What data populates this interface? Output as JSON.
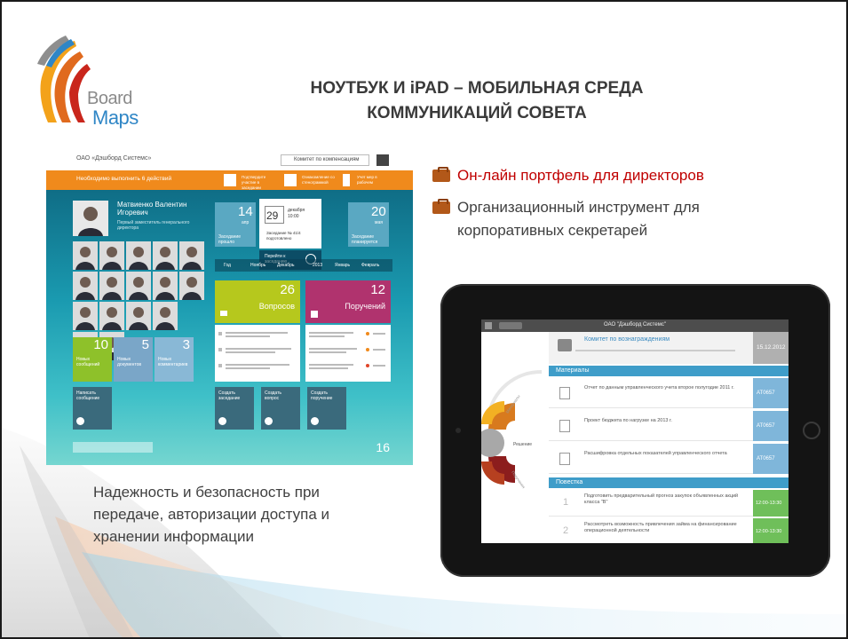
{
  "slide": {
    "title_line1": "НОУТБУК И iPAD – МОБИЛЬНАЯ  СРЕДА",
    "title_line2": "КОММУНИКАЦИЙ СОВЕТА"
  },
  "logo": {
    "line1": "Board",
    "line2": "Maps"
  },
  "bullets": [
    {
      "text": "Он-лайн портфель для директоров",
      "color": "#c00000"
    },
    {
      "text": "Организационный инструмент для корпоративных секретарей",
      "color": "#404040"
    }
  ],
  "left_caption": "Надежность и безопасность при передаче, авторизации доступа и хранении информации",
  "dashboard": {
    "org": "ОАО «Дэшборд Системс»",
    "committee_select": "Комитет по компенсациям",
    "todo": "Необходимо выполнить 6 действий",
    "chips": [
      "Подтвердите участие в заседании",
      "Ознакомление со стенограммой",
      "Учет мер в рабочем"
    ],
    "person_name": "Матвиенко Валентин Игоревич",
    "person_role": "Первый заместитель генерального директора",
    "date_left_num": "14",
    "date_left_mon": "апр",
    "date_left_label": "Заседание прошло",
    "date_center_num": "29",
    "date_center_mon": "декабря",
    "date_center_time": "10:00",
    "date_center_title": "Заседание № 41/4 подготовлено",
    "date_right_num": "20",
    "date_right_mon": "мая",
    "date_right_label": "Заседание планируется",
    "goto_label": "Перейти к заседанию",
    "months": [
      "Год",
      "Ноябрь",
      "Декабрь",
      "2013",
      "Январь",
      "Февраль"
    ],
    "questions_num": "26",
    "questions_label": "Вопросов",
    "orders_num": "12",
    "orders_label": "Поручений",
    "small_tiles": [
      {
        "num": "10",
        "label": "Новых сообщений"
      },
      {
        "num": "5",
        "label": "Новых документов"
      },
      {
        "num": "3",
        "label": "Новых комментариев"
      }
    ],
    "actions": [
      "Написать сообщение",
      "Создать заседание",
      "Создать вопрос",
      "Создать поручение"
    ],
    "clock": "16"
  },
  "ipad": {
    "header_org": "ОАО \"Дэшборд Системс\"",
    "committee": "Комитет по вознаграждениям",
    "committee_date": "15.12.2012",
    "section_materials": "Материалы",
    "materials": [
      {
        "title": "Отчет по данным управленческого учета второе полугодие 2011 г.",
        "code": "АТ0657"
      },
      {
        "title": "Проект бюджета по нагрузке на 2013 г.",
        "code": "АТ0657"
      },
      {
        "title": "Расшифровка отдельных показателей управленческого отчета",
        "code": "АТ0657"
      }
    ],
    "section_agenda": "Повестка",
    "agenda": [
      {
        "num": "1",
        "title": "Подготовить предварительный прогноз закупок объявленных акций класса \"В\"",
        "time": "12:00-13:30"
      },
      {
        "num": "2",
        "title": "Рассмотреть возможность привлечения займа на финансирование операционной деятельности",
        "time": "12:00-13:30"
      }
    ],
    "wheel_center": "Решение",
    "wheel_labels": [
      "Материалы",
      "Поручения"
    ]
  }
}
